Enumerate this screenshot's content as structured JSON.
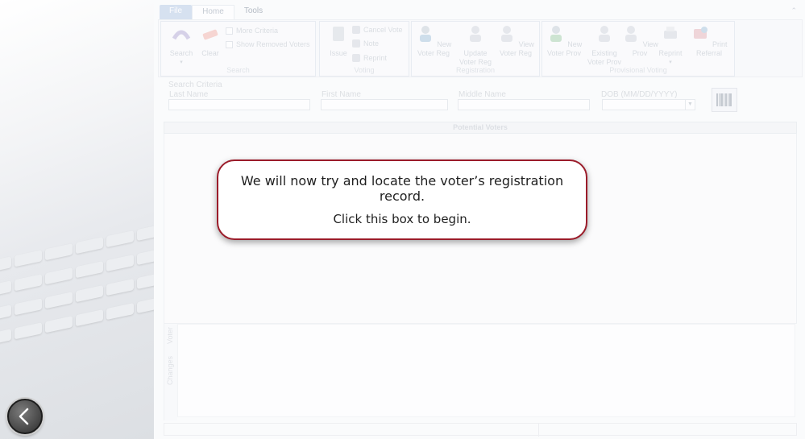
{
  "tabs": {
    "file": "File",
    "home": "Home",
    "tools": "Tools"
  },
  "ribbon": {
    "search_group": {
      "label": "Search",
      "search_button": "Search",
      "clear_button": "Clear",
      "more_criteria": "More Criteria",
      "show_removed": "Show Removed Voters"
    },
    "voting_group": {
      "label": "Voting",
      "issue_button": "Issue",
      "cancel_vote": "Cancel Vote",
      "note": "Note",
      "reprint": "Reprint"
    },
    "registration_group": {
      "label": "Registration",
      "new_voter_reg": "New Voter Reg",
      "update_voter_reg": "Update Voter Reg",
      "view_voter_reg": "View Voter Reg"
    },
    "provisional_group": {
      "label": "Provisional Voting",
      "new_voter_prov": "New Voter Prov",
      "existing_voter_prov": "Existing Voter Prov",
      "view_prov": "View Prov",
      "reprint": "Reprint",
      "print_referral": "Print Referral"
    }
  },
  "criteria": {
    "title": "Search Criteria",
    "last_name": "Last Name",
    "first_name": "First Name",
    "middle_name": "Middle Name",
    "dob": "DOB  (MM/DD/YYYY)"
  },
  "potential_voters": {
    "header": "Potential Voters"
  },
  "side_tabs": {
    "voter": "Voter",
    "changes": "Changes"
  },
  "callout": {
    "line1": "We will now try and locate the voter’s registration record.",
    "line2": "Click this box to begin."
  },
  "colors": {
    "callout_border": "#9b1c2a",
    "file_tab": "#b9cde6"
  },
  "icons": [
    "chevron-left-icon",
    "search-icon",
    "eraser-icon",
    "barcode-icon",
    "voter-person-icon",
    "printer-icon"
  ]
}
